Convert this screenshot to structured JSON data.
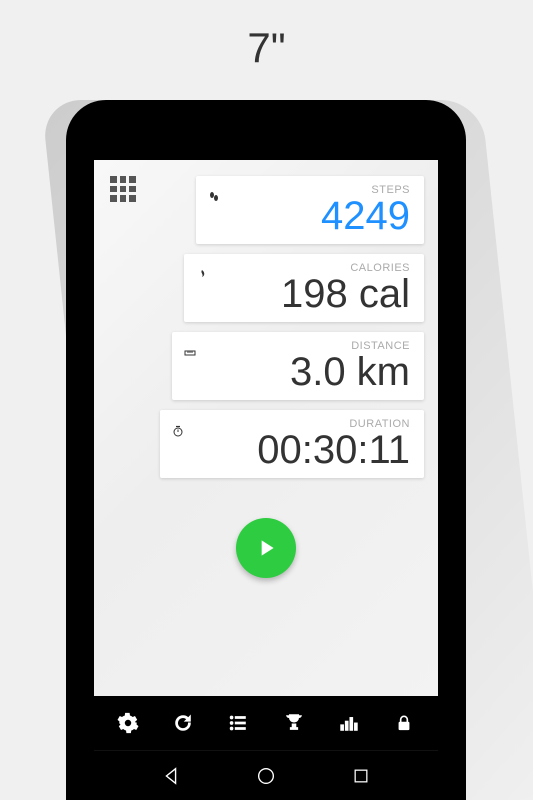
{
  "page": {
    "title": "7\""
  },
  "stats": {
    "steps": {
      "label": "STEPS",
      "value": "4249"
    },
    "calories": {
      "label": "CALORIES",
      "value": "198 cal"
    },
    "distance": {
      "label": "DISTANCE",
      "value": "3.0 km"
    },
    "duration": {
      "label": "DURATION",
      "value": "00:30:11"
    }
  },
  "colors": {
    "accent": "#1e90ff",
    "play": "#2ecc40"
  }
}
